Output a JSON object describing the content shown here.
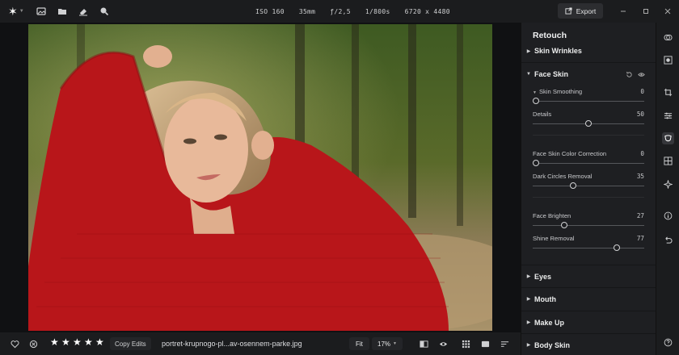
{
  "topbar": {
    "iso": "ISO 160",
    "focal": "35mm",
    "aperture": "ƒ/2,5",
    "shutter": "1/800s",
    "resolution": "6720 x 4480",
    "export_label": "Export"
  },
  "bottombar": {
    "rating": 5,
    "copy_edits_label": "Copy Edits",
    "filename": "portret-krupnogo-pl...av-osennem-parke.jpg",
    "fit_label": "Fit",
    "zoom_label": "17%"
  },
  "panel": {
    "title": "Retouch",
    "sections": {
      "skin_wrinkles": "Skin Wrinkles",
      "face_skin": "Face Skin",
      "eyes": "Eyes",
      "mouth": "Mouth",
      "make_up": "Make Up",
      "body_skin": "Body Skin"
    },
    "sliders": {
      "skin_smoothing": {
        "label": "Skin Smoothing",
        "value": "0",
        "fraction": 0.0
      },
      "details": {
        "label": "Details",
        "value": "50",
        "fraction": 0.5
      },
      "color_correction": {
        "label": "Face Skin Color Correction",
        "value": "0",
        "fraction": 0.0
      },
      "dark_circles": {
        "label": "Dark Circles Removal",
        "value": "35",
        "fraction": 0.35
      },
      "face_brighten": {
        "label": "Face Brighten",
        "value": "27",
        "fraction": 0.27
      },
      "shine_removal": {
        "label": "Shine Removal",
        "value": "77",
        "fraction": 0.77
      }
    }
  },
  "colors": {
    "background": "#17181a",
    "panel": "#1e1f22",
    "sweater": "#b8161a"
  }
}
